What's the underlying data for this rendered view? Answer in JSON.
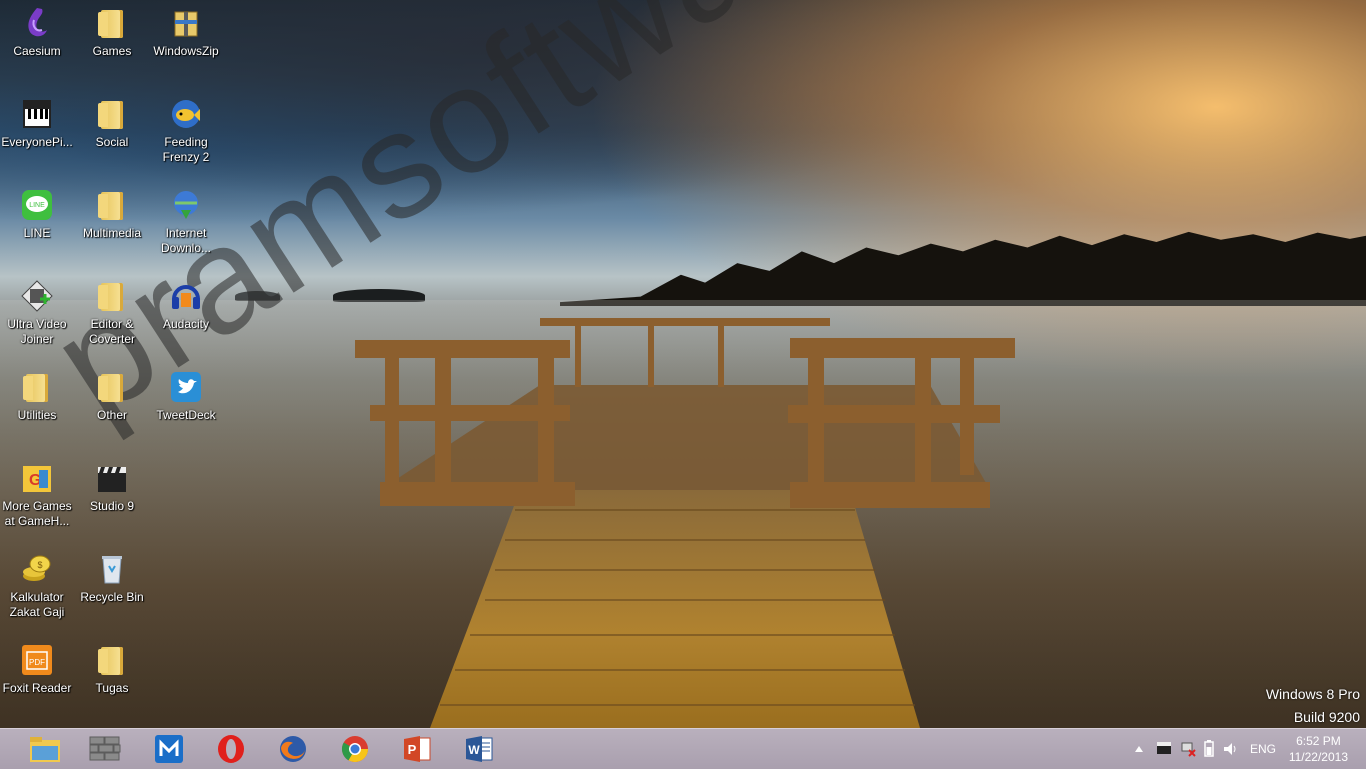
{
  "desktop": {
    "watermark": "pramsoftware.com",
    "os_name": "Windows 8 Pro",
    "os_build": "Build 9200",
    "icons": [
      {
        "label": "Caesium",
        "icon": "caesium-icon"
      },
      {
        "label": "Games",
        "icon": "folder-icon"
      },
      {
        "label": "WindowsZip",
        "icon": "windowszip-icon"
      },
      {
        "label": "EveryonePi...",
        "icon": "piano-icon"
      },
      {
        "label": "Social",
        "icon": "folder-icon"
      },
      {
        "label": "Feeding Frenzy 2",
        "icon": "fish-icon"
      },
      {
        "label": "LINE",
        "icon": "line-icon"
      },
      {
        "label": "Multimedia",
        "icon": "folder-icon"
      },
      {
        "label": "Internet Downlo...",
        "icon": "idm-icon"
      },
      {
        "label": "Ultra Video Joiner",
        "icon": "video-joiner-icon"
      },
      {
        "label": "Editor & Coverter",
        "icon": "folder-icon"
      },
      {
        "label": "Audacity",
        "icon": "headphones-icon"
      },
      {
        "label": "Utilities",
        "icon": "folder-icon"
      },
      {
        "label": "Other",
        "icon": "folder-icon"
      },
      {
        "label": "TweetDeck",
        "icon": "twitter-bird-icon"
      },
      {
        "label": "More Games at GameH...",
        "icon": "gamehouse-icon"
      },
      {
        "label": "Studio 9",
        "icon": "clapperboard-icon"
      },
      {
        "label": "Kalkulator Zakat Gaji",
        "icon": "coins-icon"
      },
      {
        "label": "Recycle Bin",
        "icon": "recycle-bin-icon"
      },
      {
        "label": "Foxit Reader",
        "icon": "pdf-icon"
      },
      {
        "label": "Tugas",
        "icon": "folder-icon"
      }
    ]
  },
  "taskbar": {
    "pinned": [
      {
        "name": "file-explorer",
        "icon": "folder-icon"
      },
      {
        "name": "wall-app",
        "icon": "brick-wall-icon"
      },
      {
        "name": "maxthon",
        "icon": "maxthon-icon"
      },
      {
        "name": "opera",
        "icon": "opera-icon"
      },
      {
        "name": "firefox",
        "icon": "firefox-icon"
      },
      {
        "name": "chrome",
        "icon": "chrome-icon"
      },
      {
        "name": "powerpoint",
        "icon": "powerpoint-icon"
      },
      {
        "name": "word",
        "icon": "word-icon"
      }
    ],
    "tray": {
      "language": "ENG",
      "time": "6:52 PM",
      "date": "11/22/2013"
    }
  },
  "colors": {
    "taskbar": "#b0a6b4",
    "folder": "#f3d77c"
  }
}
